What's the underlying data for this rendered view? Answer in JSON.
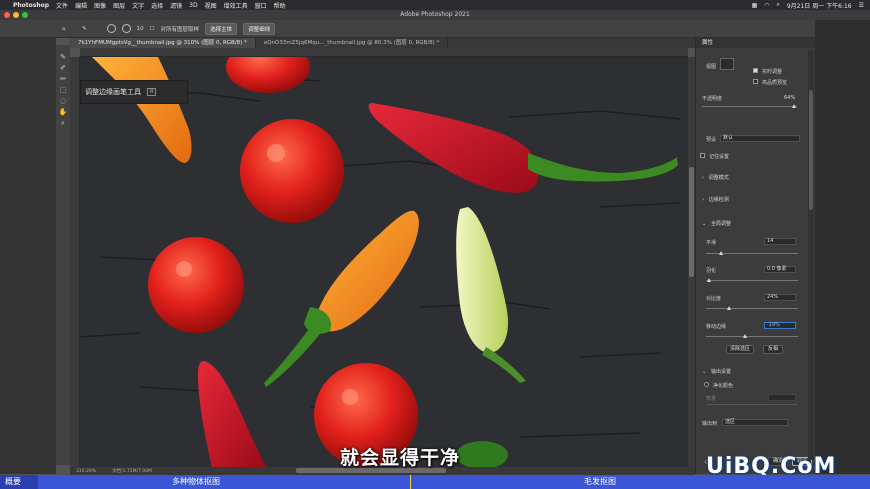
{
  "menubar": {
    "app": "Photoshop",
    "items": [
      "文件",
      "编辑",
      "图像",
      "图层",
      "文字",
      "选择",
      "滤镜",
      "3D",
      "视图",
      "增效工具",
      "窗口",
      "帮助"
    ],
    "datetime": "9月21日 周一 下午6:16"
  },
  "window": {
    "title": "Adobe Photoshop 2021"
  },
  "options": {
    "brush_size": "10",
    "sample_all": "对所有图层取样",
    "select_subject": "选择主体",
    "refine_hair": "调整细线"
  },
  "tabs": [
    {
      "label": "7k1YhFMUMgptsVg__thumbnail.jpg @ 310% (图层 0, RGB/8) *"
    },
    {
      "label": "eQnO33mZ5jq6Mqu..._thumbnail.jpg @ 80.3% (图层 0, RGB/8) *"
    }
  ],
  "tooltip": {
    "label": "调整边缘画笔工具",
    "shortcut": "R"
  },
  "status": {
    "zoom": "310.26%",
    "doc": "文档:1.75M/7.00M"
  },
  "panel": {
    "title": "属性",
    "view_label": "视图",
    "realtime": "实时调整",
    "hq_preview": "高品质预览",
    "opacity_label": "不透明度",
    "opacity_value": "64%",
    "preset_label": "预设",
    "preset_value": "默认",
    "remember": "记住设置",
    "adjust_mode": "调整模式",
    "edge_detection": "边缘检测",
    "global_refine": "全局调整",
    "smooth_label": "平滑",
    "smooth_value": "14",
    "feather_label": "羽化",
    "feather_value": "0.0 像素",
    "contrast_label": "对比度",
    "contrast_value": "24%",
    "shift_edge_label": "移动边缘",
    "shift_edge_value": "-19%",
    "clear_btn": "清除选区",
    "invert_btn": "反相",
    "output_settings": "输出设置",
    "decontam": "净化颜色",
    "amount_label": "数量",
    "output_to_label": "输出到",
    "output_to_value": "选区",
    "ok_btn": "确定",
    "cancel_btn": "取消"
  },
  "subtitle": "就会显得干净",
  "watermark": "UiBQ.CoM",
  "chapters": [
    "概要",
    "多种物体抠图",
    "毛发抠图"
  ],
  "colors": {
    "chapter_bar": "#3a55d6",
    "board": "#2d2f32",
    "red_pepper": "#c8141e",
    "orange_pepper": "#f39a1c",
    "yellow_pepper": "#dbe79a",
    "tomato": "#e2211c",
    "stem": "#3c8a22"
  }
}
